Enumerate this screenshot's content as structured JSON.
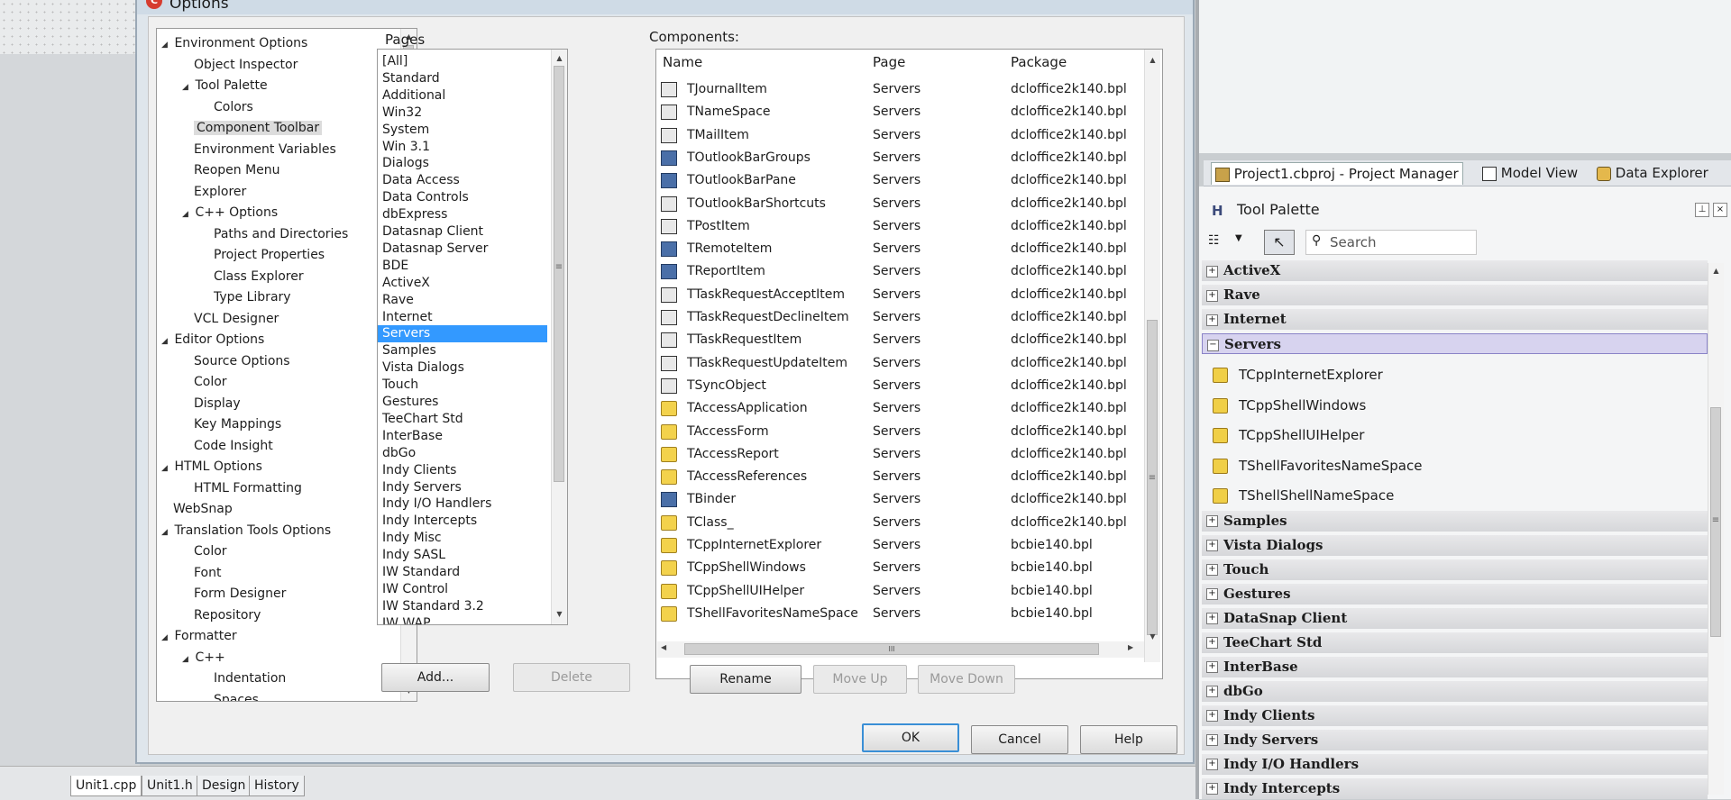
{
  "dialog": {
    "title": "Options",
    "app_icon": "cb-logo-icon"
  },
  "tree": {
    "items": [
      {
        "label": "Environment Options",
        "depth": 0,
        "expander": "open"
      },
      {
        "label": "Object Inspector",
        "depth": 1
      },
      {
        "label": "Tool Palette",
        "depth": 1,
        "expander": "open"
      },
      {
        "label": "Colors",
        "depth": 2
      },
      {
        "label": "Component Toolbar",
        "depth": 1,
        "selected": true
      },
      {
        "label": "Environment Variables",
        "depth": 1
      },
      {
        "label": "Reopen Menu",
        "depth": 1
      },
      {
        "label": "Explorer",
        "depth": 1
      },
      {
        "label": "C++ Options",
        "depth": 1,
        "expander": "open"
      },
      {
        "label": "Paths and Directories",
        "depth": 2
      },
      {
        "label": "Project Properties",
        "depth": 2
      },
      {
        "label": "Class Explorer",
        "depth": 2
      },
      {
        "label": "Type Library",
        "depth": 2
      },
      {
        "label": "VCL Designer",
        "depth": 1
      },
      {
        "label": "Editor Options",
        "depth": 0,
        "expander": "open"
      },
      {
        "label": "Source Options",
        "depth": 1
      },
      {
        "label": "Color",
        "depth": 1
      },
      {
        "label": "Display",
        "depth": 1
      },
      {
        "label": "Key Mappings",
        "depth": 1
      },
      {
        "label": "Code Insight",
        "depth": 1
      },
      {
        "label": "HTML Options",
        "depth": 0,
        "expander": "open"
      },
      {
        "label": "HTML Formatting",
        "depth": 1
      },
      {
        "label": "WebSnap",
        "depth": 0
      },
      {
        "label": "Translation Tools Options",
        "depth": 0,
        "expander": "open"
      },
      {
        "label": "Color",
        "depth": 1
      },
      {
        "label": "Font",
        "depth": 1
      },
      {
        "label": "Form Designer",
        "depth": 1
      },
      {
        "label": "Repository",
        "depth": 1
      },
      {
        "label": "Formatter",
        "depth": 0,
        "expander": "open"
      },
      {
        "label": "C++",
        "depth": 1,
        "expander": "open"
      },
      {
        "label": "Indentation",
        "depth": 2
      },
      {
        "label": "Spaces",
        "depth": 2
      }
    ]
  },
  "pages": {
    "label": "Pages",
    "items": [
      "[All]",
      "Standard",
      "Additional",
      "Win32",
      "System",
      "Win 3.1",
      "Dialogs",
      "Data Access",
      "Data Controls",
      "dbExpress",
      "Datasnap Client",
      "Datasnap Server",
      "BDE",
      "ActiveX",
      "Rave",
      "Internet",
      "Servers",
      "Samples",
      "Vista Dialogs",
      "Touch",
      "Gestures",
      "TeeChart Std",
      "InterBase",
      "dbGo",
      "Indy Clients",
      "Indy Servers",
      "Indy I/O Handlers",
      "Indy Intercepts",
      "Indy Misc",
      "Indy SASL",
      "IW Standard",
      "IW Control",
      "IW Standard 3.2",
      "IW WAP"
    ],
    "selected": "Servers"
  },
  "components": {
    "label": "Components:",
    "headers": {
      "name": "Name",
      "page": "Page",
      "package": "Package"
    },
    "rows": [
      {
        "name": "TJournalItem",
        "page": "Servers",
        "package": "dcloffice2k140.bpl",
        "icon": "grey"
      },
      {
        "name": "TNameSpace",
        "page": "Servers",
        "package": "dcloffice2k140.bpl",
        "icon": "grey"
      },
      {
        "name": "TMailItem",
        "page": "Servers",
        "package": "dcloffice2k140.bpl",
        "icon": "grey"
      },
      {
        "name": "TOutlookBarGroups",
        "page": "Servers",
        "package": "dcloffice2k140.bpl",
        "icon": "blue"
      },
      {
        "name": "TOutlookBarPane",
        "page": "Servers",
        "package": "dcloffice2k140.bpl",
        "icon": "blue"
      },
      {
        "name": "TOutlookBarShortcuts",
        "page": "Servers",
        "package": "dcloffice2k140.bpl",
        "icon": "grey"
      },
      {
        "name": "TPostItem",
        "page": "Servers",
        "package": "dcloffice2k140.bpl",
        "icon": "grey"
      },
      {
        "name": "TRemoteItem",
        "page": "Servers",
        "package": "dcloffice2k140.bpl",
        "icon": "blue"
      },
      {
        "name": "TReportItem",
        "page": "Servers",
        "package": "dcloffice2k140.bpl",
        "icon": "blue"
      },
      {
        "name": "TTaskRequestAcceptItem",
        "page": "Servers",
        "package": "dcloffice2k140.bpl",
        "icon": "grey"
      },
      {
        "name": "TTaskRequestDeclineItem",
        "page": "Servers",
        "package": "dcloffice2k140.bpl",
        "icon": "grey"
      },
      {
        "name": "TTaskRequestItem",
        "page": "Servers",
        "package": "dcloffice2k140.bpl",
        "icon": "grey"
      },
      {
        "name": "TTaskRequestUpdateItem",
        "page": "Servers",
        "package": "dcloffice2k140.bpl",
        "icon": "grey"
      },
      {
        "name": "TSyncObject",
        "page": "Servers",
        "package": "dcloffice2k140.bpl",
        "icon": "grey"
      },
      {
        "name": "TAccessApplication",
        "page": "Servers",
        "package": "dcloffice2k140.bpl",
        "icon": "yellow"
      },
      {
        "name": "TAccessForm",
        "page": "Servers",
        "package": "dcloffice2k140.bpl",
        "icon": "yellow"
      },
      {
        "name": "TAccessReport",
        "page": "Servers",
        "package": "dcloffice2k140.bpl",
        "icon": "yellow"
      },
      {
        "name": "TAccessReferences",
        "page": "Servers",
        "package": "dcloffice2k140.bpl",
        "icon": "yellow"
      },
      {
        "name": "TBinder",
        "page": "Servers",
        "package": "dcloffice2k140.bpl",
        "icon": "blue"
      },
      {
        "name": "TClass_",
        "page": "Servers",
        "package": "dcloffice2k140.bpl",
        "icon": "yellow"
      },
      {
        "name": "TCppInternetExplorer",
        "page": "Servers",
        "package": "bcbie140.bpl",
        "icon": "yellow"
      },
      {
        "name": "TCppShellWindows",
        "page": "Servers",
        "package": "bcbie140.bpl",
        "icon": "yellow"
      },
      {
        "name": "TCppShellUIHelper",
        "page": "Servers",
        "package": "bcbie140.bpl",
        "icon": "yellow"
      },
      {
        "name": "TShellFavoritesNameSpace",
        "page": "Servers",
        "package": "bcbie140.bpl",
        "icon": "yellow"
      }
    ]
  },
  "buttons": {
    "add": "Add...",
    "delete": "Delete",
    "rename": "Rename",
    "move_up": "Move Up",
    "move_down": "Move Down",
    "ok": "OK",
    "cancel": "Cancel",
    "help": "Help"
  },
  "editor_tabs": [
    "Unit1.cpp",
    "Unit1.h",
    "Design",
    "History"
  ],
  "project_tabs": [
    {
      "label": "Project1.cbproj - Project Manager",
      "icon": "project-manager-icon"
    },
    {
      "label": "Model View",
      "icon": "model-view-icon"
    },
    {
      "label": "Data Explorer",
      "icon": "data-explorer-icon"
    }
  ],
  "tool_palette": {
    "title": "Tool Palette",
    "search_placeholder": "Search",
    "categories_before": [
      "ActiveX",
      "Rave",
      "Internet"
    ],
    "open_category": "Servers",
    "items": [
      "TCppInternetExplorer",
      "TCppShellWindows",
      "TCppShellUIHelper",
      "TShellFavoritesNameSpace",
      "TShellShellNameSpace"
    ],
    "categories_after": [
      "Samples",
      "Vista Dialogs",
      "Touch",
      "Gestures",
      "DataSnap Client",
      "TeeChart Std",
      "InterBase",
      "dbGo",
      "Indy Clients",
      "Indy Servers",
      "Indy I/O Handlers",
      "Indy Intercepts"
    ]
  }
}
